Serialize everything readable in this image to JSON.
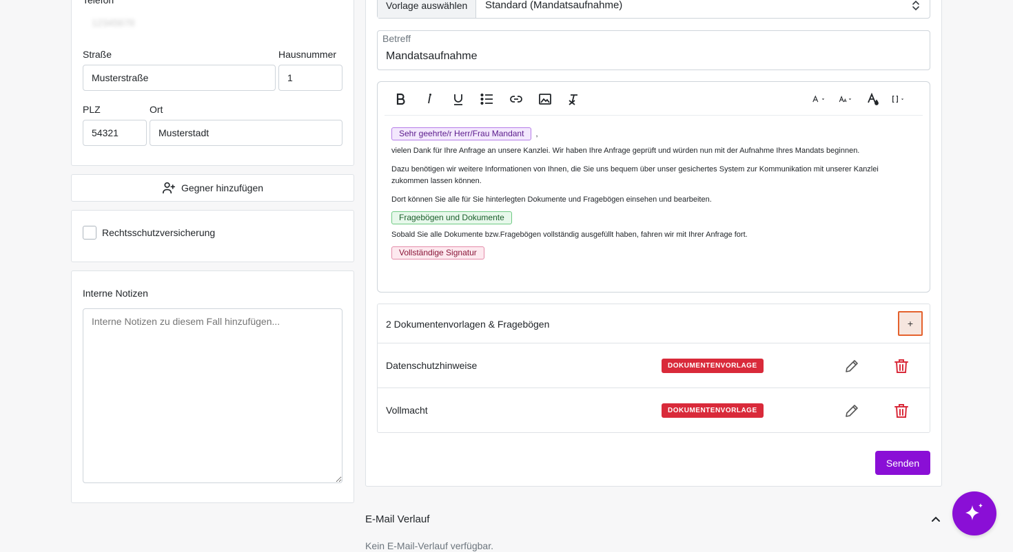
{
  "contact": {
    "phone_label": "Telefon",
    "phone_value": "12345678",
    "street_label": "Straße",
    "street_value": "Musterstraße",
    "house_label": "Hausnummer",
    "house_value": "1",
    "zip_label": "PLZ",
    "zip_value": "54321",
    "city_label": "Ort",
    "city_value": "Musterstadt"
  },
  "opponent": {
    "button_label": "Gegner hinzufügen",
    "icon": "user-plus-icon"
  },
  "insurance": {
    "checkbox_label": "Rechtsschutzversicherung",
    "checked": false
  },
  "notes": {
    "title": "Interne Notizen",
    "placeholder": "Interne Notizen zu diesem Fall hinzufügen..."
  },
  "template": {
    "prefix_label": "Vorlage auswählen",
    "selected": "Standard (Mandatsaufnahme)"
  },
  "subject": {
    "label": "Betreff",
    "value": "Mandatsaufnahme"
  },
  "editor": {
    "toolbar": [
      "bold-icon",
      "italic-icon",
      "underline-icon",
      "list-icon",
      "link-icon",
      "image-icon",
      "clear-format-icon",
      "font-icon",
      "font-size-icon",
      "color-icon",
      "placeholder-icon"
    ],
    "salutation_chip": "Sehr geehrte/r Herr/Frau Mandant",
    "salutation_suffix": ",",
    "p1": "vielen Dank für Ihre Anfrage an unsere Kanzlei. Wir haben Ihre Anfrage geprüft und würden nun mit der Aufnahme Ihres Mandats beginnen.",
    "p2": "Dazu benötigen wir weitere Informationen von Ihnen, die Sie uns bequem über unser gesichertes System zur Kommunikation mit unserer Kanzlei zukommen lassen können.",
    "p3": "Dort können Sie alle für Sie hinterlegten Dokumente und Fragebögen einsehen und bearbeiten.",
    "docs_chip": "Fragebögen und Dokumente",
    "p4": "Sobald Sie alle Dokumente bzw.Fragebögen vollständig ausgefüllt haben, fahren wir mit Ihrer Anfrage fort.",
    "signature_chip": "Vollständige Signatur"
  },
  "documents": {
    "header": "2 Dokumentenvorlagen & Fragebögen",
    "add_label": "+",
    "items": [
      {
        "name": "Datenschutzhinweise",
        "badge": "DOKUMENTENVORLAGE"
      },
      {
        "name": "Vollmacht",
        "badge": "DOKUMENTENVORLAGE"
      }
    ]
  },
  "send_label": "Senden",
  "history": {
    "title": "E-Mail Verlauf",
    "empty": "Kein E-Mail-Verlauf verfügbar."
  },
  "colors": {
    "accent": "#8a0fd6",
    "badge": "#d92a3a",
    "highlight": "#e4612c"
  }
}
